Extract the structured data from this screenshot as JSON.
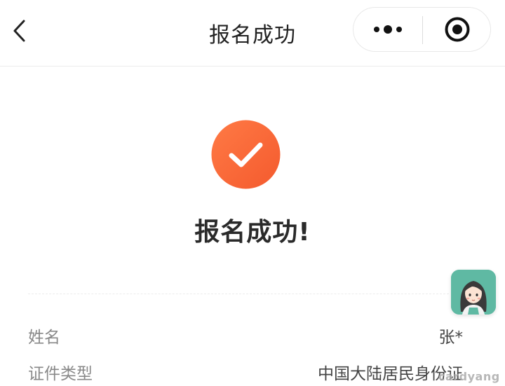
{
  "navbar": {
    "title": "报名成功",
    "back_icon": "chevron-left-icon",
    "more_icon": "more-dots-icon",
    "close_icon": "target-close-icon"
  },
  "success": {
    "title": "报名成功!",
    "icon": "check-circle-icon",
    "icon_color": "#ff6a3d"
  },
  "info": {
    "rows": [
      {
        "label": "姓名",
        "value": "张*"
      },
      {
        "label": "证件类型",
        "value": "中国大陆居民身份证"
      }
    ]
  },
  "floating_avatar": {
    "icon": "girl-avatar-icon",
    "bg_color": "#5fb9a3"
  },
  "watermark": {
    "text": "cardyang"
  }
}
